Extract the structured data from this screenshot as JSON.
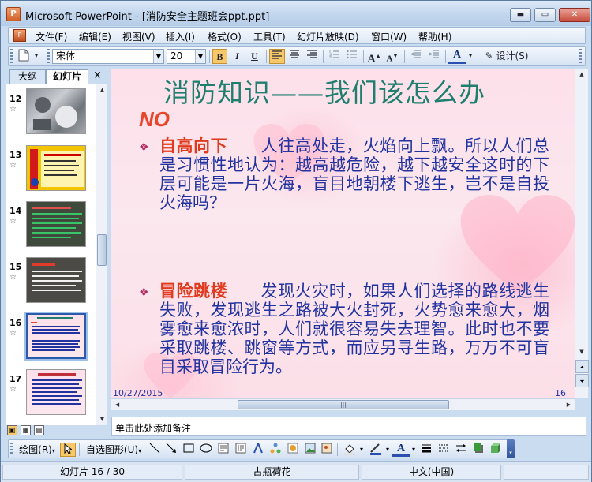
{
  "window": {
    "app_icon_letter": "P",
    "title": "Microsoft PowerPoint - [消防安全主题班会ppt.ppt]",
    "min_label": "▬",
    "max_label": "▭",
    "close_label": "✕"
  },
  "menu": {
    "doc_icon_letter": "P",
    "items": [
      "文件(F)",
      "编辑(E)",
      "视图(V)",
      "插入(I)",
      "格式(O)",
      "工具(T)",
      "幻灯片放映(D)",
      "窗口(W)",
      "帮助(H)"
    ]
  },
  "toolbar": {
    "font_name": "宋体",
    "font_size": "20",
    "bold": "B",
    "italic": "I",
    "underline": "U",
    "grow_font": "A",
    "shrink_font": "A",
    "font_color": "A",
    "design_label": "设计(S)",
    "new_icon": "new-document-icon"
  },
  "left_panel": {
    "tabs": [
      "大纲",
      "幻灯片"
    ],
    "active_tab": "幻灯片",
    "close_label": "×",
    "slides": [
      {
        "number": "12",
        "star": "☆"
      },
      {
        "number": "13",
        "star": "☆"
      },
      {
        "number": "14",
        "star": "☆"
      },
      {
        "number": "15",
        "star": "☆"
      },
      {
        "number": "16",
        "star": "☆"
      },
      {
        "number": "17",
        "star": "☆"
      }
    ],
    "selected_slide": "16"
  },
  "slide": {
    "title": "消防知识——我们该怎么办",
    "subtitle": "NO",
    "bullets": [
      {
        "marker": "❖",
        "heading": "自高向下",
        "text": "人往高处走，火焰向上飘。所以人们总是习惯性地认为：越高越危险，越下越安全这时的下层可能是一片火海，盲目地朝楼下逃生，岂不是自投火海吗？"
      },
      {
        "marker": "❖",
        "heading": "冒险跳楼",
        "text": "发现火灾时，如果人们选择的路线逃生失败，发现逃生之路被大火封死，火势愈来愈大，烟雾愈来愈浓时，人们就很容易失去理智。此时也不要采取跳楼、跳窗等方式，而应另寻生路，万万不可盲目采取冒险行为。"
      }
    ],
    "date": "10/27/2015",
    "page_number": "16",
    "background_color": "#fce3ec",
    "title_color": "#1f7f6f",
    "text_color": "#2233a0",
    "heading_color": "#e03a1e"
  },
  "notes": {
    "placeholder": "单击此处添加备注"
  },
  "drawing_toolbar": {
    "draw_label": "绘图(R)",
    "autoshapes_label": "自选图形(U)"
  },
  "status": {
    "slide_position": "幻灯片 16 / 30",
    "template": "古瓶荷花",
    "language": "中文(中国)"
  }
}
